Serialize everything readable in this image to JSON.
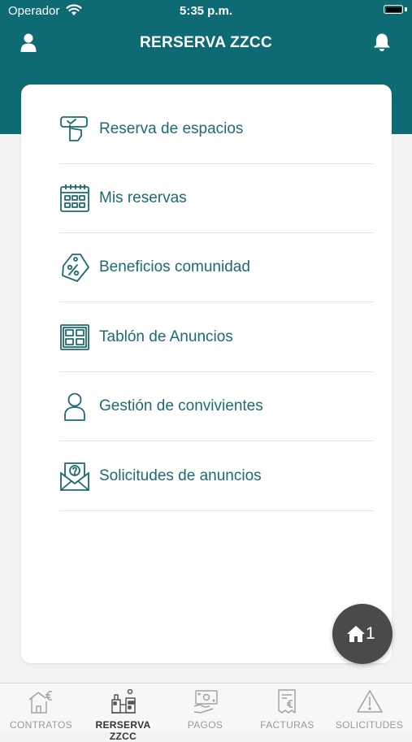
{
  "status_bar": {
    "carrier": "Operador",
    "time": "5:35 p.m."
  },
  "header": {
    "title": "RERSERVA ZZCC"
  },
  "menu": {
    "items": [
      {
        "label": "Reserva de espacios",
        "icon": "hand-touch-icon"
      },
      {
        "label": "Mis reservas",
        "icon": "calendar-icon"
      },
      {
        "label": "Beneficios comunidad",
        "icon": "discount-tag-icon"
      },
      {
        "label": "Tablón de Anuncios",
        "icon": "notice-board-icon"
      },
      {
        "label": "Gestión de convivientes",
        "icon": "person-icon"
      },
      {
        "label": "Solicitudes de anuncios",
        "icon": "envelope-question-icon"
      }
    ]
  },
  "fab": {
    "count": "1",
    "icon": "home-icon"
  },
  "tab_bar": {
    "tabs": [
      {
        "label": "CONTRATOS",
        "icon": "house-euro-icon",
        "active": false
      },
      {
        "label": "RERSERVA ZZCC",
        "icon": "community-icon",
        "active": true
      },
      {
        "label": "PAGOS",
        "icon": "hand-bill-icon",
        "active": false
      },
      {
        "label": "FACTURAS",
        "icon": "invoice-euro-icon",
        "active": false
      },
      {
        "label": "SOLICITUDES",
        "icon": "warning-icon",
        "active": false
      }
    ]
  },
  "colors": {
    "primary": "#0e6b73",
    "text_accent": "#1d6a73",
    "fab": "#4a4a4a"
  }
}
